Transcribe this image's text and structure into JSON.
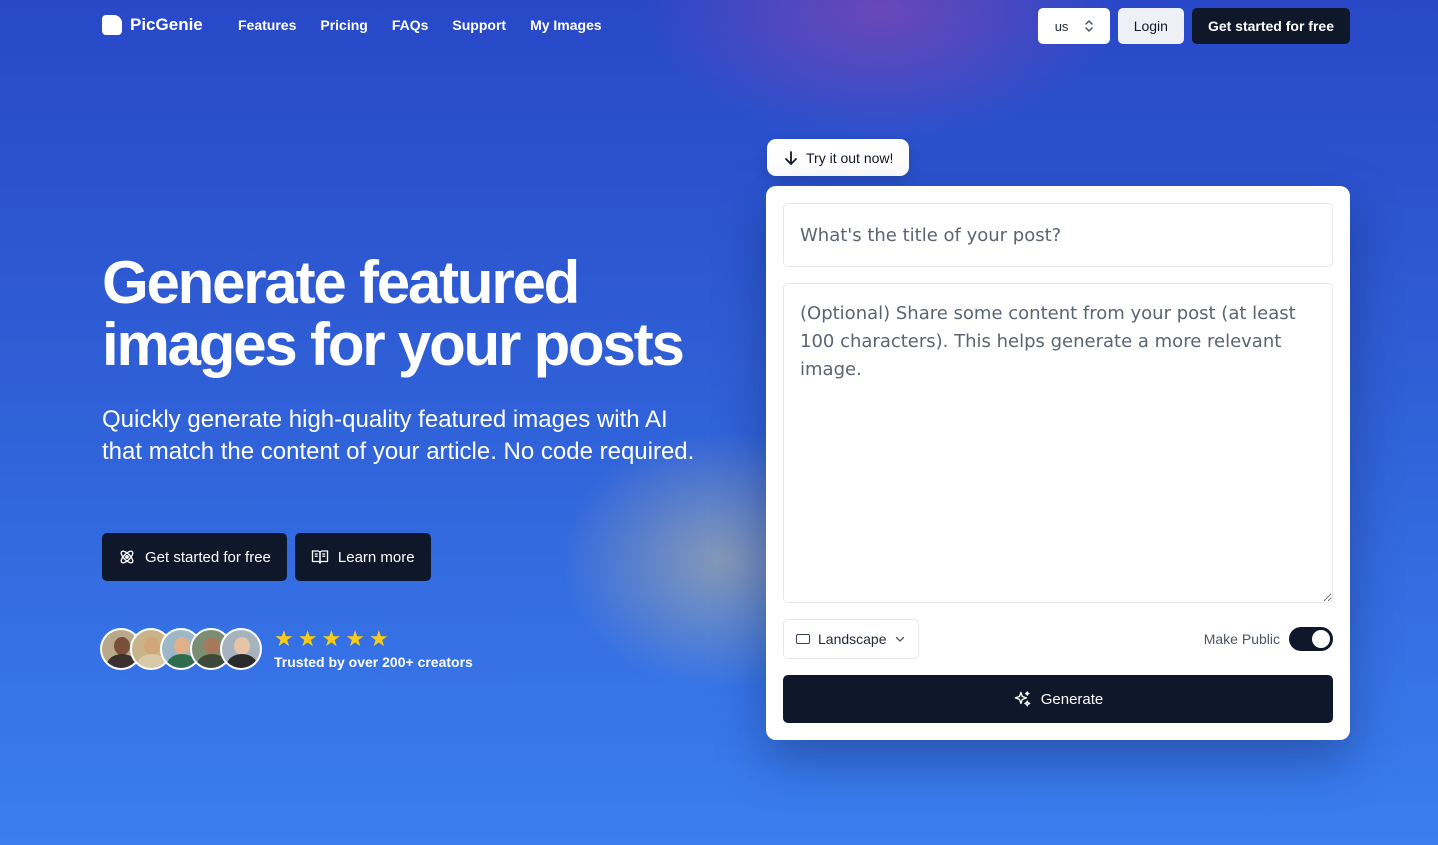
{
  "brand": {
    "name": "PicGenie"
  },
  "nav": {
    "links": [
      "Features",
      "Pricing",
      "FAQs",
      "Support",
      "My Images"
    ],
    "locale": "us",
    "login_label": "Login",
    "cta_label": "Get started for free"
  },
  "hero": {
    "title": "Generate featured images for your posts",
    "subtitle": "Quickly generate high-quality featured images with AI that match the content of your article. No code required.",
    "primary_cta": "Get started for free",
    "secondary_cta": "Learn more",
    "rating": 5,
    "trusted_text": "Trusted by over 200+ creators"
  },
  "generator": {
    "try_label": "Try it out now!",
    "title_placeholder": "What's the title of your post?",
    "content_placeholder": "(Optional) Share some content from your post (at least 100 characters). This helps generate a more relevant image.",
    "orientation": "Landscape",
    "make_public_label": "Make Public",
    "make_public_on": true,
    "generate_label": "Generate"
  },
  "colors": {
    "accent_dark": "#0f172a",
    "background_top": "#2848c8",
    "background_bottom": "#3a7ef0",
    "star": "#facc15"
  }
}
